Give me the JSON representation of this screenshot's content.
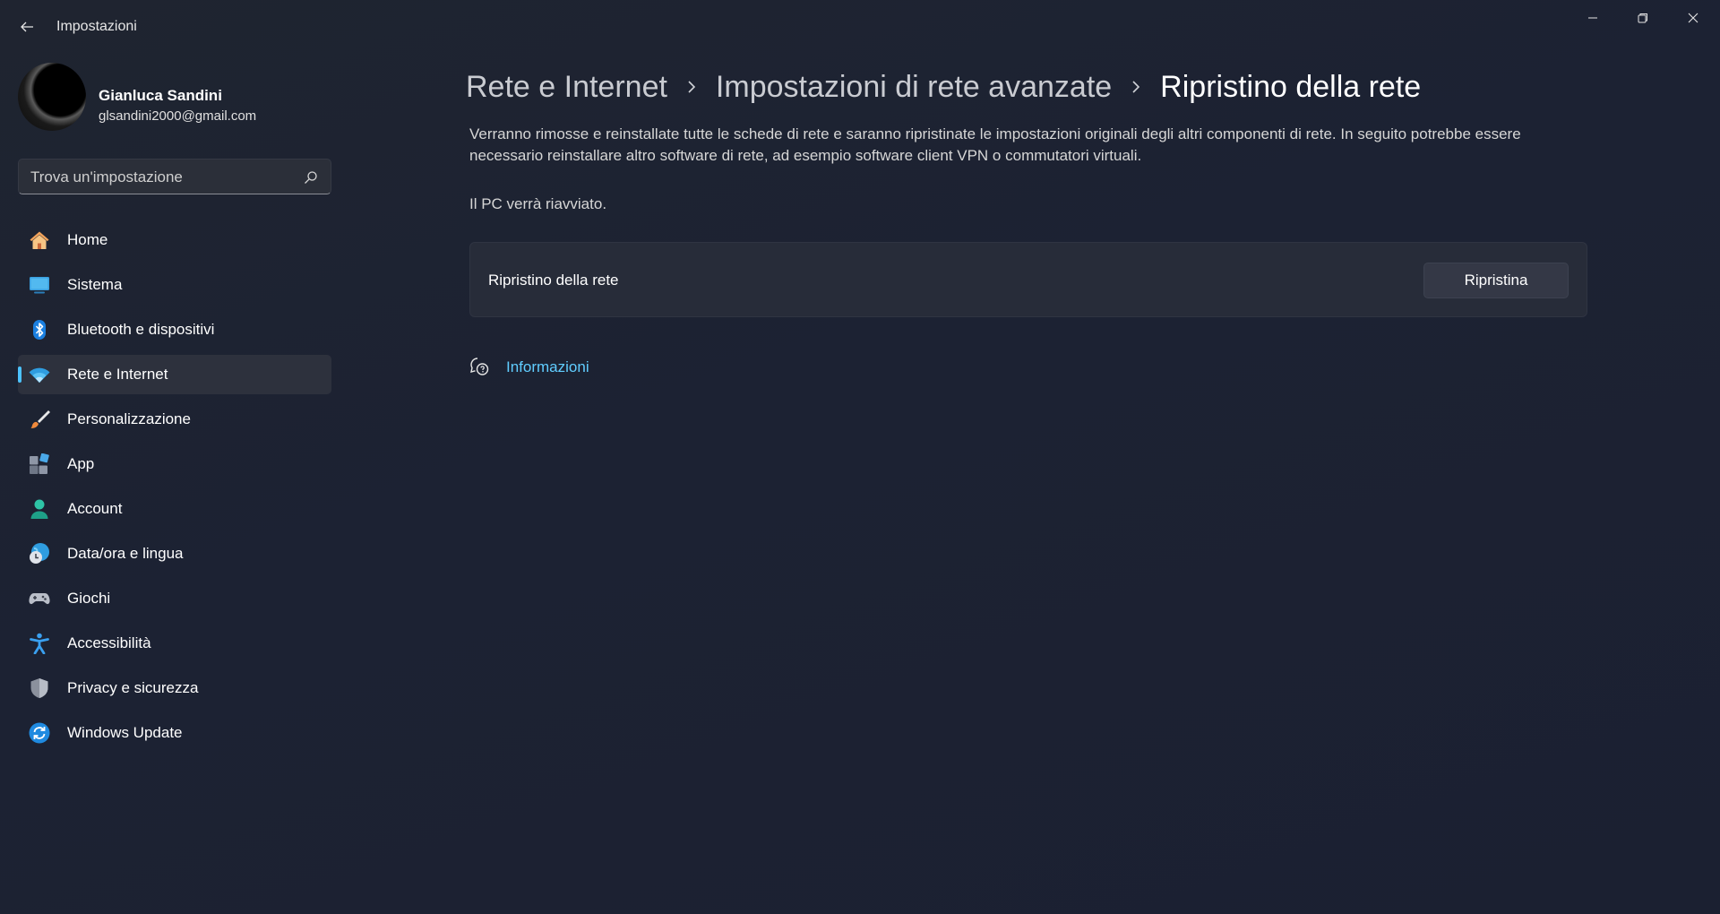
{
  "window": {
    "title": "Impostazioni",
    "back_icon": "back-arrow-icon",
    "controls": [
      "minimize-icon",
      "restore-icon",
      "close-icon"
    ]
  },
  "profile": {
    "name": "Gianluca Sandini",
    "email": "glsandini2000@gmail.com"
  },
  "search": {
    "placeholder": "Trova un'impostazione",
    "icon": "search-icon"
  },
  "sidebar": {
    "accent_color": "#4cc2ff",
    "items": [
      {
        "label": "Home",
        "icon": "home-icon",
        "selected": false
      },
      {
        "label": "Sistema",
        "icon": "display-icon",
        "selected": false
      },
      {
        "label": "Bluetooth e dispositivi",
        "icon": "bluetooth-icon",
        "selected": false
      },
      {
        "label": "Rete e Internet",
        "icon": "wifi-icon",
        "selected": true
      },
      {
        "label": "Personalizzazione",
        "icon": "brush-icon",
        "selected": false
      },
      {
        "label": "App",
        "icon": "apps-icon",
        "selected": false
      },
      {
        "label": "Account",
        "icon": "person-icon",
        "selected": false
      },
      {
        "label": "Data/ora e lingua",
        "icon": "globe-clock-icon",
        "selected": false
      },
      {
        "label": "Giochi",
        "icon": "gamepad-icon",
        "selected": false
      },
      {
        "label": "Accessibilità",
        "icon": "accessibility-icon",
        "selected": false
      },
      {
        "label": "Privacy e sicurezza",
        "icon": "shield-icon",
        "selected": false
      },
      {
        "label": "Windows Update",
        "icon": "update-icon",
        "selected": false
      }
    ]
  },
  "breadcrumb": {
    "items": [
      "Rete e Internet",
      "Impostazioni di rete avanzate",
      "Ripristino della rete"
    ]
  },
  "main": {
    "description": "Verranno rimosse e reinstallate tutte le schede di rete e saranno ripristinate le impostazioni originali degli altri componenti di rete. In seguito potrebbe essere necessario reinstallare altro software di rete, ad esempio software client VPN o commutatori virtuali.",
    "restart_note": "Il PC verrà riavviato.",
    "card": {
      "label": "Ripristino della rete",
      "button_label": "Ripristina"
    },
    "help": {
      "link_label": "Informazioni",
      "icon": "help-chat-icon",
      "link_color": "#60cdff"
    }
  }
}
